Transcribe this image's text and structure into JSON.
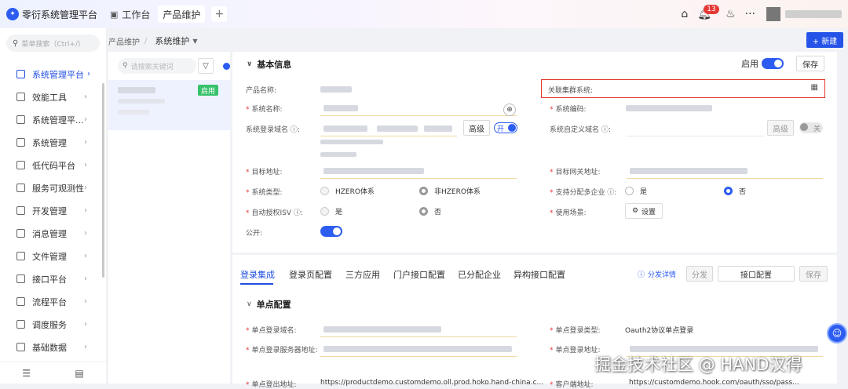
{
  "app": {
    "name": "零衍系统管理平台"
  },
  "tabs": [
    {
      "label": "工作台",
      "icon": "monitor-icon"
    },
    {
      "label": "产品维护"
    }
  ],
  "topbar": {
    "notification_count": "13",
    "more": "···"
  },
  "sidebar": {
    "search_placeholder": "菜单搜索（Ctrl+/）",
    "items": [
      {
        "label": "系统管理平台"
      },
      {
        "label": "效能工具"
      },
      {
        "label": "系统管理平..."
      },
      {
        "label": "系统管理"
      },
      {
        "label": "低代码平台"
      },
      {
        "label": "服务可观测性"
      },
      {
        "label": "开发管理"
      },
      {
        "label": "消息管理"
      },
      {
        "label": "文件管理"
      },
      {
        "label": "接口平台"
      },
      {
        "label": "流程平台"
      },
      {
        "label": "调度服务"
      },
      {
        "label": "基础数据"
      }
    ]
  },
  "breadcrumb": {
    "parent": "产品维护",
    "current": "系统维护"
  },
  "header": {
    "new_button": "+ 新建"
  },
  "list": {
    "search_placeholder": "请搜索关键词",
    "status_tag": "启用"
  },
  "form": {
    "section_title": "基本信息",
    "enable_label": "启用",
    "save_button": "保存",
    "labels": {
      "product_name": "产品名称:",
      "related_cluster": "关联集群系统:",
      "system_name": "系统名称:",
      "system_code": "系统编码:",
      "login_domain": "系统登录域名",
      "custom_domain": "系统自定义域名",
      "target_address": "目标地址:",
      "target_gateway": "目标网关地址:",
      "system_type": "系统类型:",
      "multi_enterprise": "支持分配多企业",
      "auto_isv": "自动授权ISV",
      "usage_scene": "使用场景:",
      "public": "公开:"
    },
    "advanced_button": "高级",
    "switch_on": "开",
    "switch_off": "关",
    "radios": {
      "hzero": "HZERO体系",
      "non_hzero": "非HZERO体系",
      "yes": "是",
      "no": "否"
    },
    "settings_button": "设置"
  },
  "panel": {
    "tabs": [
      "登录集成",
      "登录页配置",
      "三方应用",
      "门户接口配置",
      "已分配企业",
      "异构接口配置"
    ],
    "distribute_detail": "分发详情",
    "distribute_button": "分发",
    "interface_config_button": "接口配置",
    "save_button": "保存",
    "sub_title": "单点配置",
    "labels": {
      "sso_domain": "单点登录域名:",
      "sso_type": "单点登录类型:",
      "sso_server": "单点登录服务器地址:",
      "sso_login": "单点登录地址:",
      "sso_logout": "单点登出地址:",
      "client_url": "客户端地址:"
    },
    "sso_type_value": "Oauth2协议单点登录",
    "logout_value": "https://productdemo.customdemo.oll.prod.hoko.hand-china.c...",
    "client_value": "https://customdemo.hook.com/oauth/sso/pass..."
  },
  "watermark": "掘金技术社区 @ HAND汉得",
  "colors": {
    "accent": "#2c5cf0",
    "highlight_border": "#e03a2f",
    "enabled_tag": "#37c26b"
  }
}
